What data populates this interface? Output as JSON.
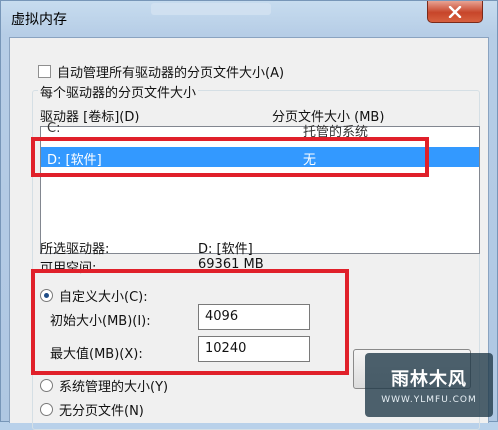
{
  "window": {
    "title": "虚拟内存"
  },
  "auto_manage": {
    "label": "自动管理所有驱动器的分页文件大小(A)",
    "checked": false
  },
  "group": {
    "title": "每个驱动器的分页文件大小",
    "col_drive": "驱动器 [卷标](D)",
    "col_size": "分页文件大小 (MB)"
  },
  "drives": [
    {
      "drive": "C:",
      "size": "托管的系统"
    },
    {
      "drive": "D:  [软件]",
      "size": "无",
      "selected": true
    }
  ],
  "selected_info": {
    "drive_label": "所选驱动器:",
    "drive_value": "D:  [软件]",
    "space_label": "可用空间:",
    "space_value": "69361 MB"
  },
  "custom_size": {
    "label": "自定义大小(C):",
    "checked": true,
    "initial_label": "初始大小(MB)(I):",
    "initial_value": "4096",
    "max_label": "最大值(MB)(X):",
    "max_value": "10240"
  },
  "system_managed": {
    "label": "系统管理的大小(Y)"
  },
  "no_paging": {
    "label": "无分页文件(N)"
  },
  "watermark": {
    "text": "雨林木风",
    "url": "WWW.YLMFU.COM"
  },
  "colors": {
    "highlight": "#e0202a",
    "selection": "#3399ff",
    "close": "#c7452a"
  }
}
